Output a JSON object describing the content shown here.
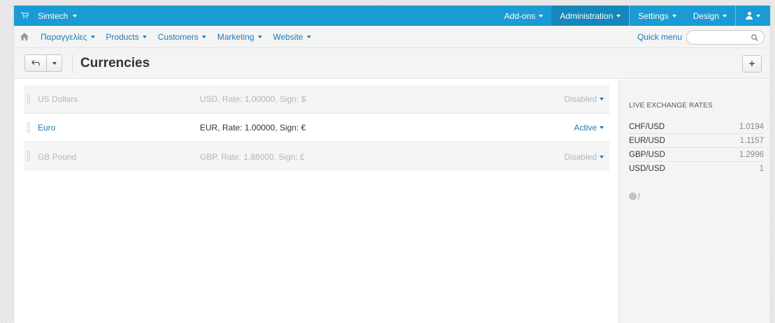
{
  "topbar": {
    "brand": "Simtech",
    "addons": "Add-ons",
    "administration": "Administration",
    "settings": "Settings",
    "design": "Design"
  },
  "nav": {
    "items": [
      "Παραγγελίες",
      "Products",
      "Customers",
      "Marketing",
      "Website"
    ],
    "quick_menu": "Quick menu",
    "search_placeholder": ""
  },
  "toolbar": {
    "title": "Currencies",
    "add_label": "+"
  },
  "currencies": [
    {
      "name": "US Dollars",
      "info": "USD, Rate: 1.00000, Sign: $",
      "status": "Disabled"
    },
    {
      "name": "Euro",
      "info": "EUR, Rate: 1.00000, Sign: €",
      "status": "Active"
    },
    {
      "name": "GB Pound",
      "info": "GBP, Rate: 1.88000, Sign: £",
      "status": "Disabled"
    }
  ],
  "sidebar": {
    "title": "LIVE EXCHANGE RATES",
    "rates": [
      {
        "pair": "CHF/USD",
        "value": "1.0194"
      },
      {
        "pair": "EUR/USD",
        "value": "1.1157"
      },
      {
        "pair": "GBP/USD",
        "value": "1.2996"
      },
      {
        "pair": "USD/USD",
        "value": "1"
      }
    ],
    "provider_icon": "yahoo-logo-icon"
  },
  "colors": {
    "topbar": "#1a9bd3",
    "link": "#1a7ab8",
    "disabled_text": "#b5b5b5"
  }
}
